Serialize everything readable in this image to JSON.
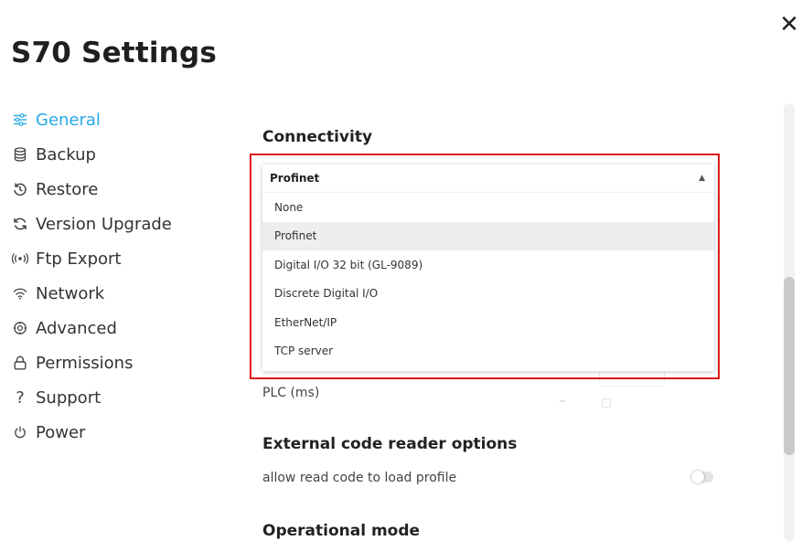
{
  "header": {
    "title": "S70 Settings",
    "close_icon": "close-icon"
  },
  "sidebar": {
    "active_color": "#29a9e6",
    "items": [
      {
        "label": "General",
        "icon": "sliders-icon",
        "active": true
      },
      {
        "label": "Backup",
        "icon": "database-icon"
      },
      {
        "label": "Restore",
        "icon": "restore-icon"
      },
      {
        "label": "Version Upgrade",
        "icon": "refresh-icon"
      },
      {
        "label": "Ftp Export",
        "icon": "broadcast-icon"
      },
      {
        "label": "Network",
        "icon": "wifi-icon"
      },
      {
        "label": "Advanced",
        "icon": "gear-icon"
      },
      {
        "label": "Permissions",
        "icon": "lock-icon"
      },
      {
        "label": "Support",
        "icon": "question-icon"
      },
      {
        "label": "Power",
        "icon": "power-icon"
      }
    ]
  },
  "main": {
    "connectivity": {
      "heading": "Connectivity",
      "selected": "Profinet",
      "options": [
        "None",
        "Profinet",
        "Digital I/O 32 bit (GL-9089)",
        "Discrete Digital I/O",
        "EtherNet/IP",
        "TCP server"
      ]
    },
    "polling": {
      "label": "PLC (ms)"
    },
    "external_reader": {
      "heading": "External code reader options",
      "option_label": "allow read code to load profile",
      "toggle_on": false
    },
    "operational_mode": {
      "heading": "Operational mode"
    }
  },
  "annotation": {
    "highlight_color": "#e01818"
  }
}
